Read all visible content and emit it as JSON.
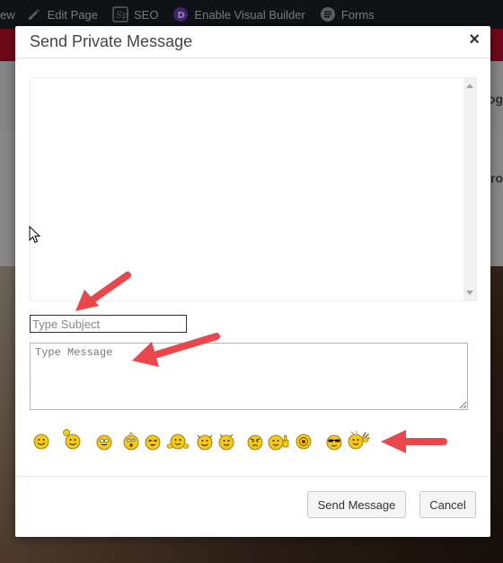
{
  "admin_bar": {
    "items": [
      {
        "label": "ew",
        "icon": "none"
      },
      {
        "label": "Edit Page",
        "icon": "pencil-icon"
      },
      {
        "label": "SEO",
        "icon": "seo-plugin-icon"
      },
      {
        "label": "Enable Visual Builder",
        "icon": "divi-logo-icon"
      },
      {
        "label": "Forms",
        "icon": "forms-icon"
      }
    ]
  },
  "background": {
    "edge_text_1": "og",
    "edge_text_2": "ro"
  },
  "modal": {
    "title": "Send Private Message",
    "close_glyph": "×",
    "subject": {
      "value": "",
      "placeholder": "Type Subject"
    },
    "message": {
      "value": "",
      "placeholder": "Type Message"
    },
    "emoticons": [
      "smile-emoticon",
      "waving-hat-emoticon",
      "grin-emoticon",
      "surprised-emoticon",
      "laughing-emoticon",
      "hugging-emoticon",
      "cheering-emoticon",
      "dancing-emoticon",
      "angry-emoticon",
      "thumbs-up-emoticon",
      "shocked-emoticon",
      "cool-sunglasses-emoticon",
      "waving-hand-emoticon"
    ],
    "buttons": {
      "send": "Send Message",
      "cancel": "Cancel"
    }
  },
  "colors": {
    "admin_bar": "#1d2327",
    "site_header_red": "#c8102e",
    "annotation_arrow": "#e8484c",
    "emoticon_yellow": "#f6c915"
  }
}
